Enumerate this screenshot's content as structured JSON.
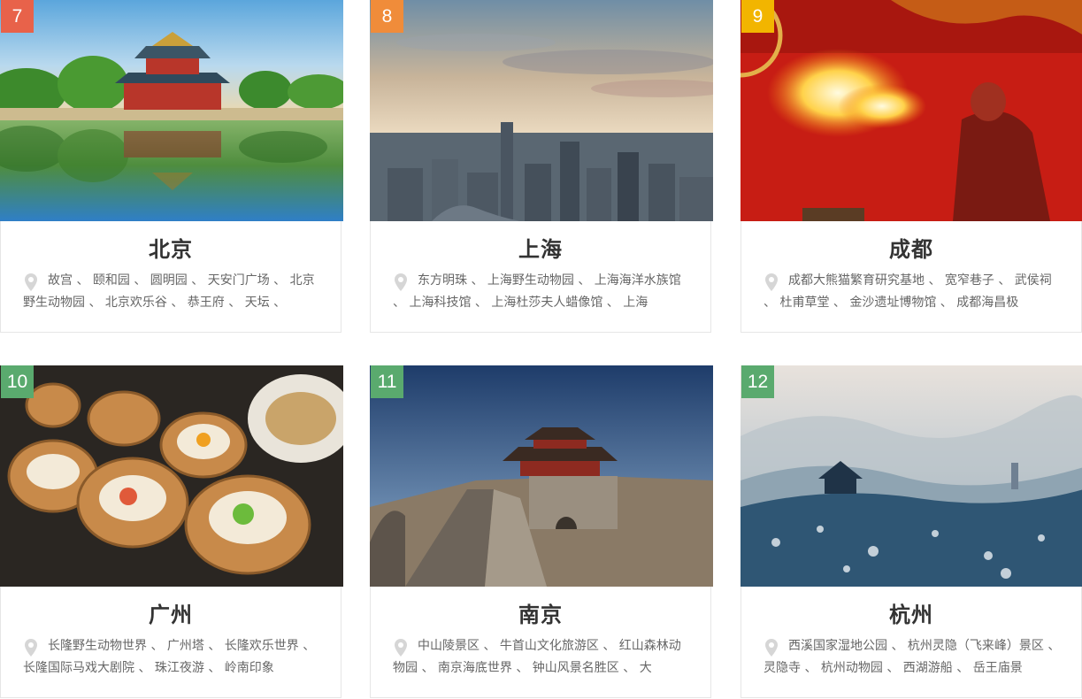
{
  "cards": [
    {
      "rank": "7",
      "rank_color": "#e8624a",
      "city": "北京",
      "spots": "故宫 、 颐和园 、 圆明园 、 天安门广场 、 北京野生动物园 、 北京欢乐谷 、 恭王府 、 天坛 、"
    },
    {
      "rank": "8",
      "rank_color": "#f08c3a",
      "city": "上海",
      "spots": "东方明珠 、 上海野生动物园 、 上海海洋水族馆 、 上海科技馆 、 上海杜莎夫人蜡像馆 、 上海"
    },
    {
      "rank": "9",
      "rank_color": "#f2b500",
      "city": "成都",
      "spots": "成都大熊猫繁育研究基地 、 宽窄巷子 、 武侯祠 、 杜甫草堂 、 金沙遗址博物馆 、 成都海昌极"
    },
    {
      "rank": "10",
      "rank_color": "#5aaa6e",
      "city": "广州",
      "spots": "长隆野生动物世界 、 广州塔 、 长隆欢乐世界 、 长隆国际马戏大剧院 、 珠江夜游 、 岭南印象"
    },
    {
      "rank": "11",
      "rank_color": "#5aaa6e",
      "city": "南京",
      "spots": "中山陵景区 、 牛首山文化旅游区 、 红山森林动物园 、 南京海底世界 、 钟山风景名胜区 、 大"
    },
    {
      "rank": "12",
      "rank_color": "#5aaa6e",
      "city": "杭州",
      "spots": "西溪国家湿地公园 、 杭州灵隐（飞来峰）景区 、 灵隐寺 、 杭州动物园 、 西湖游船 、 岳王庙景"
    }
  ]
}
